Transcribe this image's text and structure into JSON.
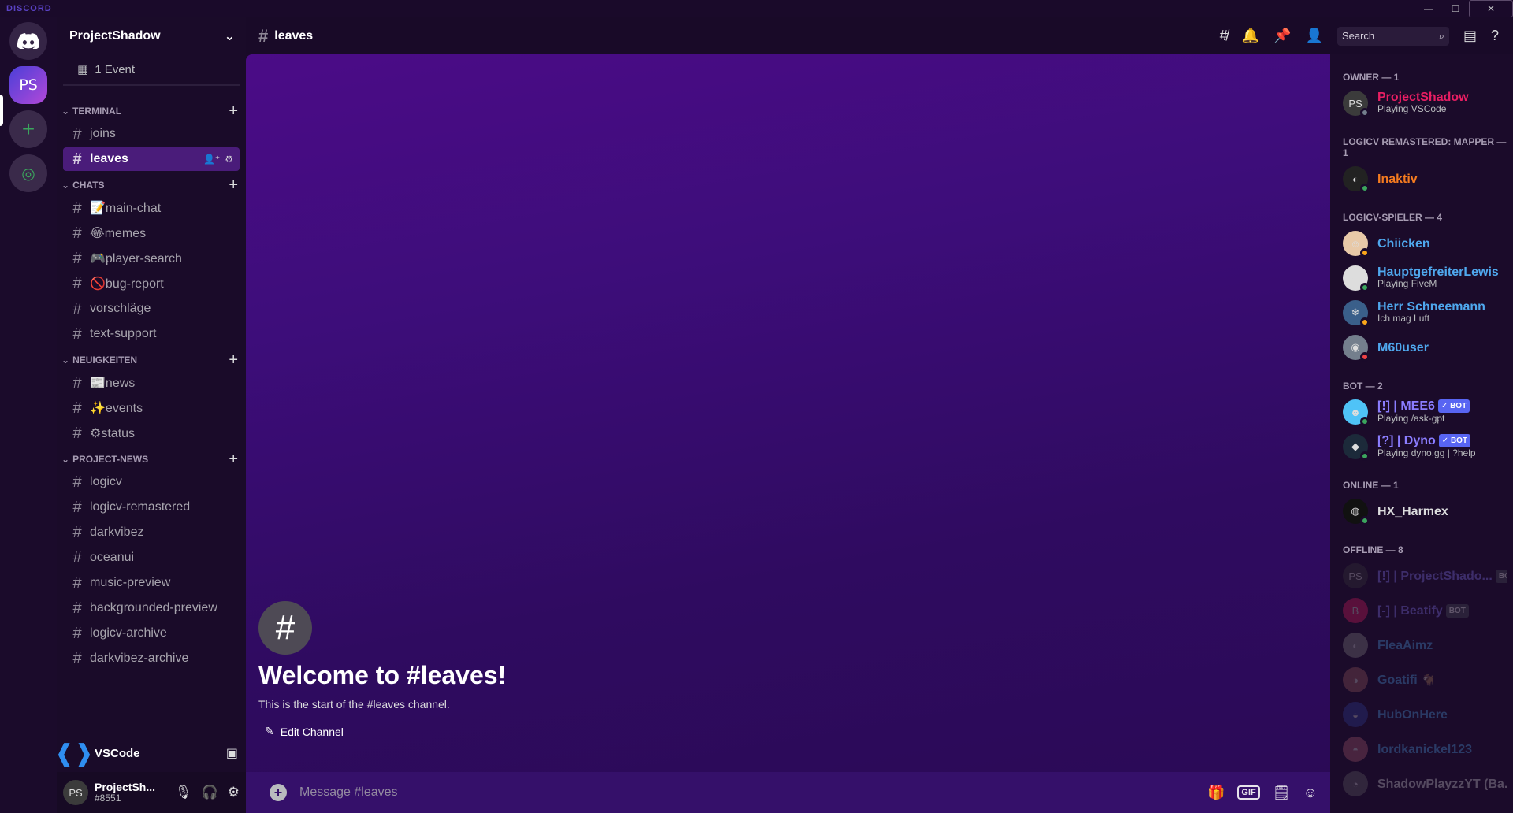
{
  "titlebar": {
    "wordmark": "DISCORD",
    "controls": {
      "minimize": "—",
      "maximize": "☐",
      "close": "✕"
    }
  },
  "rail": {
    "active_server_initials": "PS",
    "add_label": "+",
    "explore_label": "◎"
  },
  "guild": {
    "name": "ProjectShadow",
    "event_label": "1 Event"
  },
  "categories": [
    {
      "name": "TERMINAL",
      "channels": [
        {
          "name": "joins"
        },
        {
          "name": "leaves",
          "active": true
        }
      ]
    },
    {
      "name": "CHATS",
      "channels": [
        {
          "name": "📝main-chat"
        },
        {
          "name": "😂memes"
        },
        {
          "name": "🎮player-search"
        },
        {
          "name": "🚫bug-report"
        },
        {
          "name": "vorschläge"
        },
        {
          "name": "text-support"
        }
      ]
    },
    {
      "name": "NEUIGKEITEN",
      "channels": [
        {
          "name": "📰news"
        },
        {
          "name": "✨events"
        },
        {
          "name": "⚙status"
        }
      ]
    },
    {
      "name": "PROJECT-NEWS",
      "channels": [
        {
          "name": "logicv"
        },
        {
          "name": "logicv-remastered"
        },
        {
          "name": "darkvibez"
        },
        {
          "name": "oceanui"
        },
        {
          "name": "music-preview"
        },
        {
          "name": "backgrounded-preview"
        },
        {
          "name": "logicv-archive"
        },
        {
          "name": "darkvibez-archive"
        }
      ]
    }
  ],
  "activity": {
    "name": "VSCode"
  },
  "user": {
    "name": "ProjectSh...",
    "tag": "#8551",
    "initials": "PS"
  },
  "header": {
    "channel": "leaves",
    "search_placeholder": "Search"
  },
  "welcome": {
    "title": "Welcome to #leaves!",
    "subtitle": "This is the start of the #leaves channel.",
    "edit_label": "Edit Channel"
  },
  "composer": {
    "placeholder": "Message #leaves",
    "gif_label": "GIF"
  },
  "member_groups": [
    {
      "label": "OWNER — 1",
      "members": [
        {
          "name": "ProjectShadow",
          "activity": "Playing VSCode",
          "color": "#e91e63",
          "avatar": "PS",
          "avbg": "#3b3b3b",
          "status": "#747f8d"
        }
      ]
    },
    {
      "label": "LOGICV REMASTERED: MAPPER — 1",
      "members": [
        {
          "name": "Inaktiv",
          "activity": "",
          "color": "#f47b20",
          "avatar": "◐",
          "avbg": "#222222",
          "status": "#3ba55d"
        }
      ]
    },
    {
      "label": "LOGICV-SPIELER — 4",
      "members": [
        {
          "name": "Chiicken",
          "activity": "",
          "color": "#4fa8ee",
          "avatar": "☺",
          "avbg": "#e8c9a8",
          "status": "#faa61a"
        },
        {
          "name": "HauptgefreiterLewis",
          "activity": "Playing FiveM",
          "color": "#4fa8ee",
          "avatar": "☻",
          "avbg": "#dddddd",
          "status": "#3ba55d"
        },
        {
          "name": "Herr Schneemann",
          "activity": "Ich mag Luft",
          "color": "#4fa8ee",
          "avatar": "❄",
          "avbg": "#3a5f8a",
          "status": "#faa61a"
        },
        {
          "name": "M60user",
          "activity": "",
          "color": "#4fa8ee",
          "avatar": "◉",
          "avbg": "#747f8d",
          "status": "#ed4245"
        }
      ]
    },
    {
      "label": "BOT — 2",
      "members": [
        {
          "name": "[!] | MEE6",
          "activity": "Playing /ask-gpt",
          "color": "#8b7dff",
          "avatar": "☻",
          "avbg": "#4fc3f7",
          "status": "#3ba55d",
          "badge": "✓ BOT"
        },
        {
          "name": "[?] | Dyno",
          "activity": "Playing dyno.gg | ?help",
          "color": "#8b7dff",
          "avatar": "◆",
          "avbg": "#1c2a3a",
          "status": "#3ba55d",
          "badge": "✓ BOT"
        }
      ]
    },
    {
      "label": "ONLINE — 1",
      "members": [
        {
          "name": "HX_Harmex",
          "activity": "",
          "color": "#dcddde",
          "avatar": "◍",
          "avbg": "#111111",
          "status": "#3ba55d"
        }
      ]
    },
    {
      "label": "OFFLINE — 8",
      "offline": true,
      "members": [
        {
          "name": "[!] | ProjectShado...",
          "activity": "",
          "color": "#8b7dff",
          "avatar": "PS",
          "avbg": "#3b3b3b",
          "badge": "BOT"
        },
        {
          "name": "[-] | Beatify",
          "activity": "",
          "color": "#8b7dff",
          "avatar": "B",
          "avbg": "#e91e63",
          "badge": "BOT"
        },
        {
          "name": "FleaAimz",
          "activity": "",
          "color": "#4fa8ee",
          "avatar": "◐",
          "avbg": "#888888"
        },
        {
          "name": "Goatifi 🐐",
          "activity": "",
          "color": "#4fa8ee",
          "avatar": "◑",
          "avbg": "#a06060"
        },
        {
          "name": "HubOnHere",
          "activity": "",
          "color": "#4fa8ee",
          "avatar": "◒",
          "avbg": "#3040a0"
        },
        {
          "name": "lordkanickel123",
          "activity": "",
          "color": "#4fa8ee",
          "avatar": "◓",
          "avbg": "#b06070"
        },
        {
          "name": "ShadowPlayzzYT (Ba...",
          "activity": "",
          "color": "#dcddde",
          "avatar": "◔",
          "avbg": "#666666"
        }
      ]
    }
  ]
}
